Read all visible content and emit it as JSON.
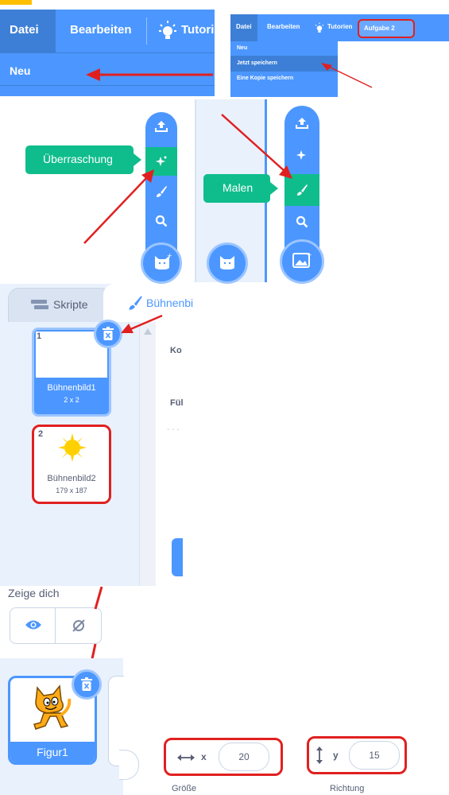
{
  "menu_large": {
    "datei": "Datei",
    "bearbeiten": "Bearbeiten",
    "tutorien": "Tutorien",
    "neu": "Neu"
  },
  "menu_small": {
    "datei": "Datei",
    "bearbeiten": "Bearbeiten",
    "tutorien": "Tutorien",
    "project_title": "Aufgabe 2",
    "items": [
      "Neu",
      "Jetzt speichern",
      "Eine Kopie speichern"
    ]
  },
  "choose_menu": {
    "surprise_label": "Überraschung",
    "paint_label": "Malen"
  },
  "tabs": {
    "scripts": "Skripte",
    "backdrops": "Bühnenbi"
  },
  "backdrops": [
    {
      "index": "1",
      "name": "Bühnenbild1",
      "size": "2 x 2"
    },
    {
      "index": "2",
      "name": "Bühnenbild2",
      "size": "179 x 187"
    }
  ],
  "editor_snippets": {
    "costume": "Ko",
    "fill": "Fül",
    "dashes": "- - -"
  },
  "show": {
    "label": "Zeige dich"
  },
  "sprite": {
    "name": "Figur1"
  },
  "position": {
    "x_label": "x",
    "x_value": "20",
    "y_label": "y",
    "y_value": "15"
  },
  "props": {
    "size_label": "Größe",
    "direction_label": "Richtung"
  },
  "colors": {
    "accent": "#4c97ff",
    "green": "#0fbd8c",
    "highlight": "#e02020",
    "menu_dark": "#3d7fd6"
  }
}
